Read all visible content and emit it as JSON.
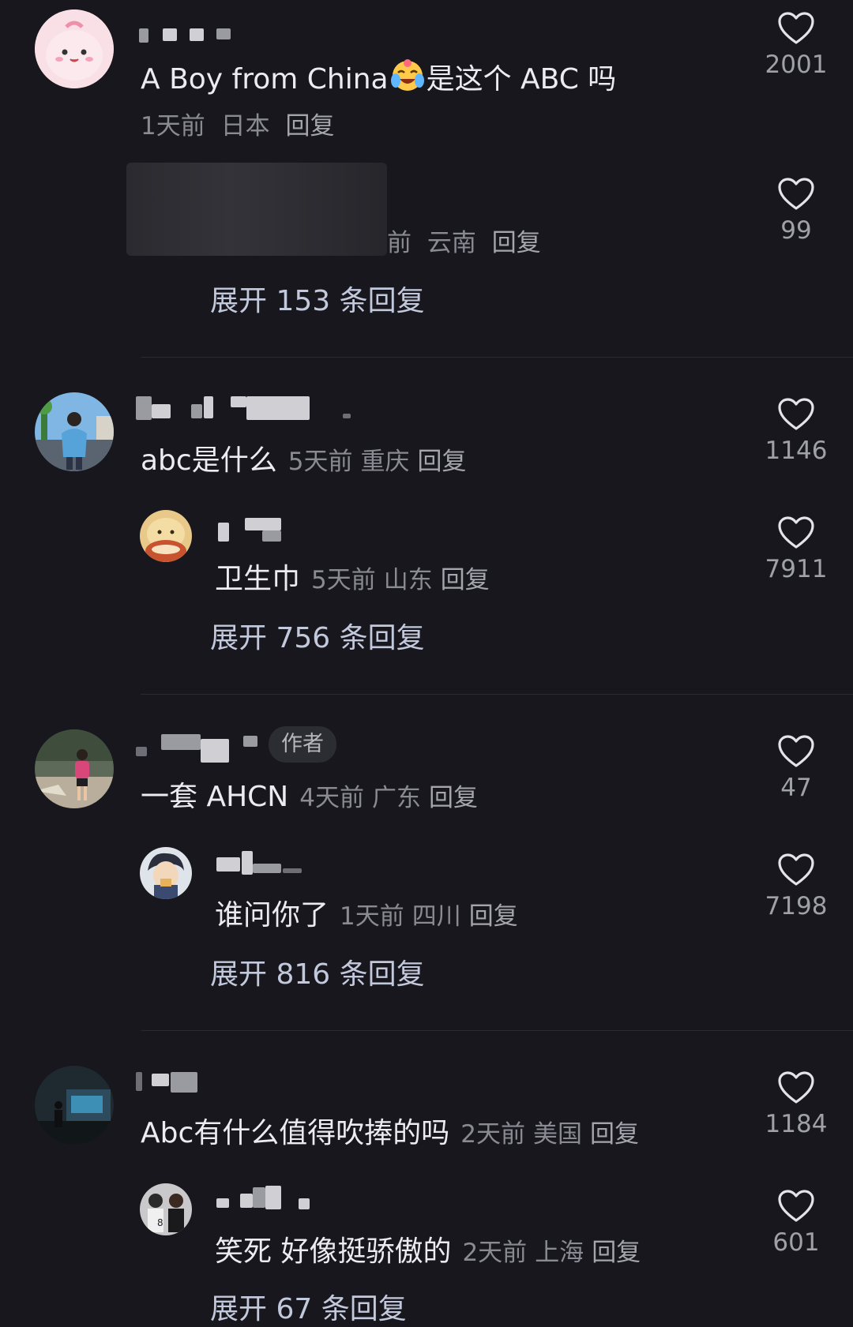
{
  "comments": [
    {
      "text_a": "A Boy from China",
      "emoji": "crying-laughing-emoji",
      "text_b": "是这个 ABC 吗",
      "time": "1天前",
      "location": "日本",
      "reply_label": "回复",
      "likes": "2001",
      "sub": {
        "time_partial": "前",
        "location": "云南",
        "reply_label": "回复",
        "likes": "99"
      },
      "expand": "展开 153 条回复"
    },
    {
      "text": "abc是什么",
      "time": "5天前",
      "location": "重庆",
      "reply_label": "回复",
      "likes": "1146",
      "sub": {
        "text": "卫生巾",
        "time": "5天前",
        "location": "山东",
        "reply_label": "回复",
        "likes": "7911"
      },
      "expand": "展开 756 条回复"
    },
    {
      "badge": "作者",
      "text": "一套 AHCN",
      "time": "4天前",
      "location": "广东",
      "reply_label": "回复",
      "likes": "47",
      "sub": {
        "text": "谁问你了",
        "time": "1天前",
        "location": "四川",
        "reply_label": "回复",
        "likes": "7198"
      },
      "expand": "展开 816 条回复"
    },
    {
      "text": "Abc有什么值得吹捧的吗",
      "time": "2天前",
      "location": "美国",
      "reply_label": "回复",
      "likes": "1184",
      "sub": {
        "text": "笑死 好像挺骄傲的",
        "time": "2天前",
        "location": "上海",
        "reply_label": "回复",
        "likes": "601"
      },
      "expand": "展开 67 条回复"
    }
  ],
  "colors": {
    "background": "#17171d",
    "text": "#ececf0",
    "meta": "#8a8a92",
    "expand": "#c3c9dc"
  },
  "icons": {
    "like": "heart-outline-icon"
  }
}
